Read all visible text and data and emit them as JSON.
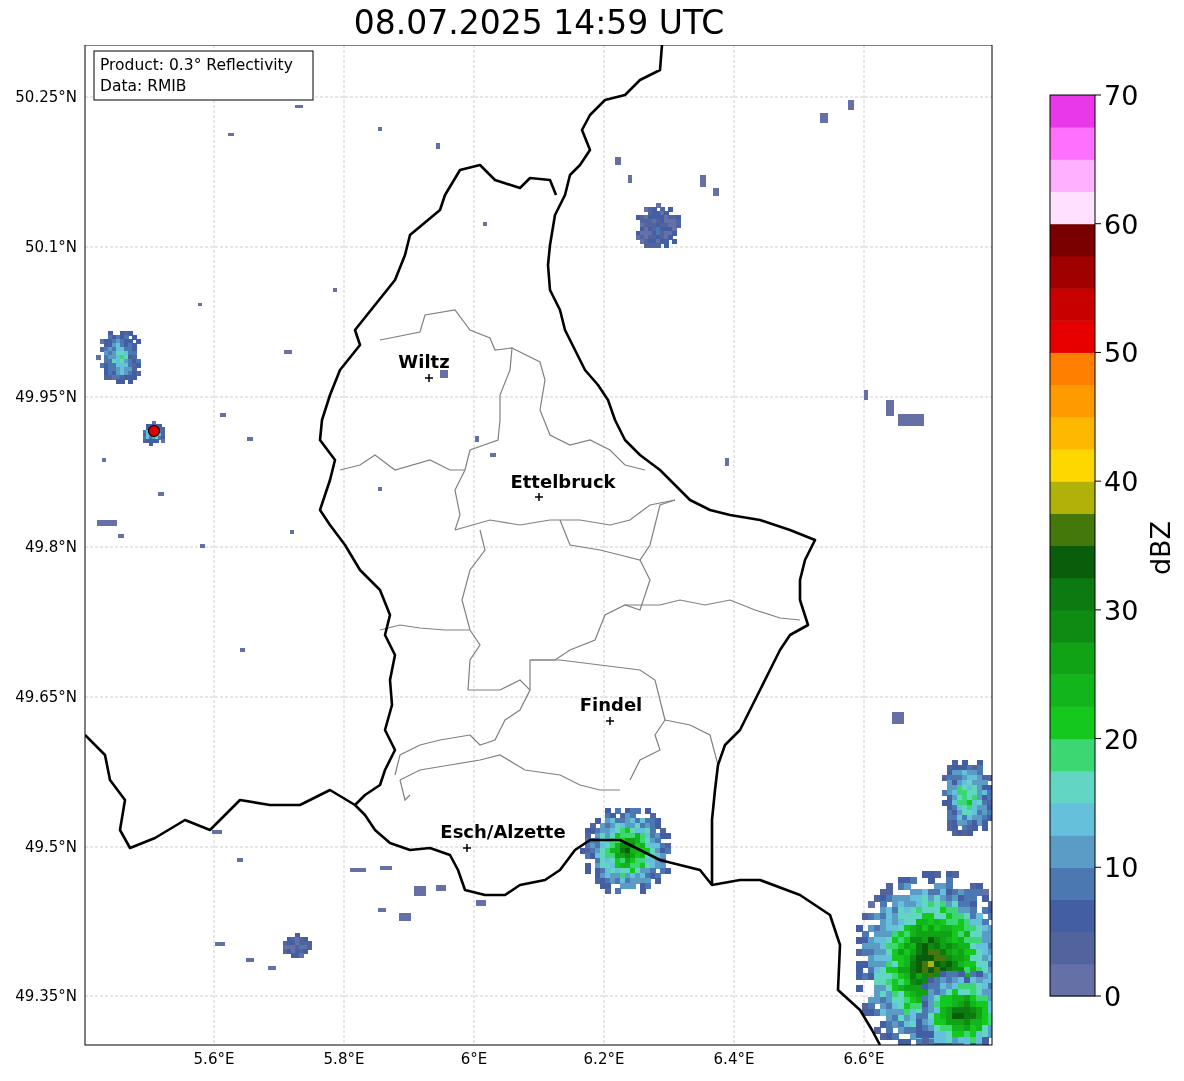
{
  "title": "08.07.2025 14:59 UTC",
  "info_box": {
    "lines": [
      "Product: 0.3° Reflectivity",
      "Data: RMIB"
    ]
  },
  "map": {
    "lat_labels": [
      "50.25°N",
      "50.1°N",
      "49.95°N",
      "49.8°N",
      "49.65°N",
      "49.5°N",
      "49.35°N"
    ],
    "lon_labels": [
      "5.6°E",
      "5.8°E",
      "6°E",
      "6.2°E",
      "6.4°E",
      "6.6°E"
    ],
    "cities": [
      {
        "name": "Wiltz"
      },
      {
        "name": "Ettelbruck"
      },
      {
        "name": "Findel"
      },
      {
        "name": "Esch/Alzette"
      }
    ]
  },
  "colorbar": {
    "label": "dBZ",
    "ticks": [
      "70",
      "60",
      "50",
      "40",
      "30",
      "20",
      "10",
      "0"
    ],
    "segments": [
      {
        "color": "#6470a6"
      },
      {
        "color": "#52649e"
      },
      {
        "color": "#435ea2"
      },
      {
        "color": "#4c78b1"
      },
      {
        "color": "#5b9cc7"
      },
      {
        "color": "#65c0dc"
      },
      {
        "color": "#63d6c3"
      },
      {
        "color": "#3cd672"
      },
      {
        "color": "#14c81e"
      },
      {
        "color": "#12b61a"
      },
      {
        "color": "#10a315"
      },
      {
        "color": "#0e8b12"
      },
      {
        "color": "#0c7a10"
      },
      {
        "color": "#0a5d0b"
      },
      {
        "color": "#45780b"
      },
      {
        "color": "#b0b20a"
      },
      {
        "color": "#ffd700"
      },
      {
        "color": "#ffb800"
      },
      {
        "color": "#ff9a00"
      },
      {
        "color": "#ff8000"
      },
      {
        "color": "#e60000"
      },
      {
        "color": "#c80000"
      },
      {
        "color": "#a00000"
      },
      {
        "color": "#7a0000"
      },
      {
        "color": "#ffe0ff"
      },
      {
        "color": "#ffb0ff"
      },
      {
        "color": "#ff70ff"
      },
      {
        "color": "#e838e8"
      }
    ]
  }
}
